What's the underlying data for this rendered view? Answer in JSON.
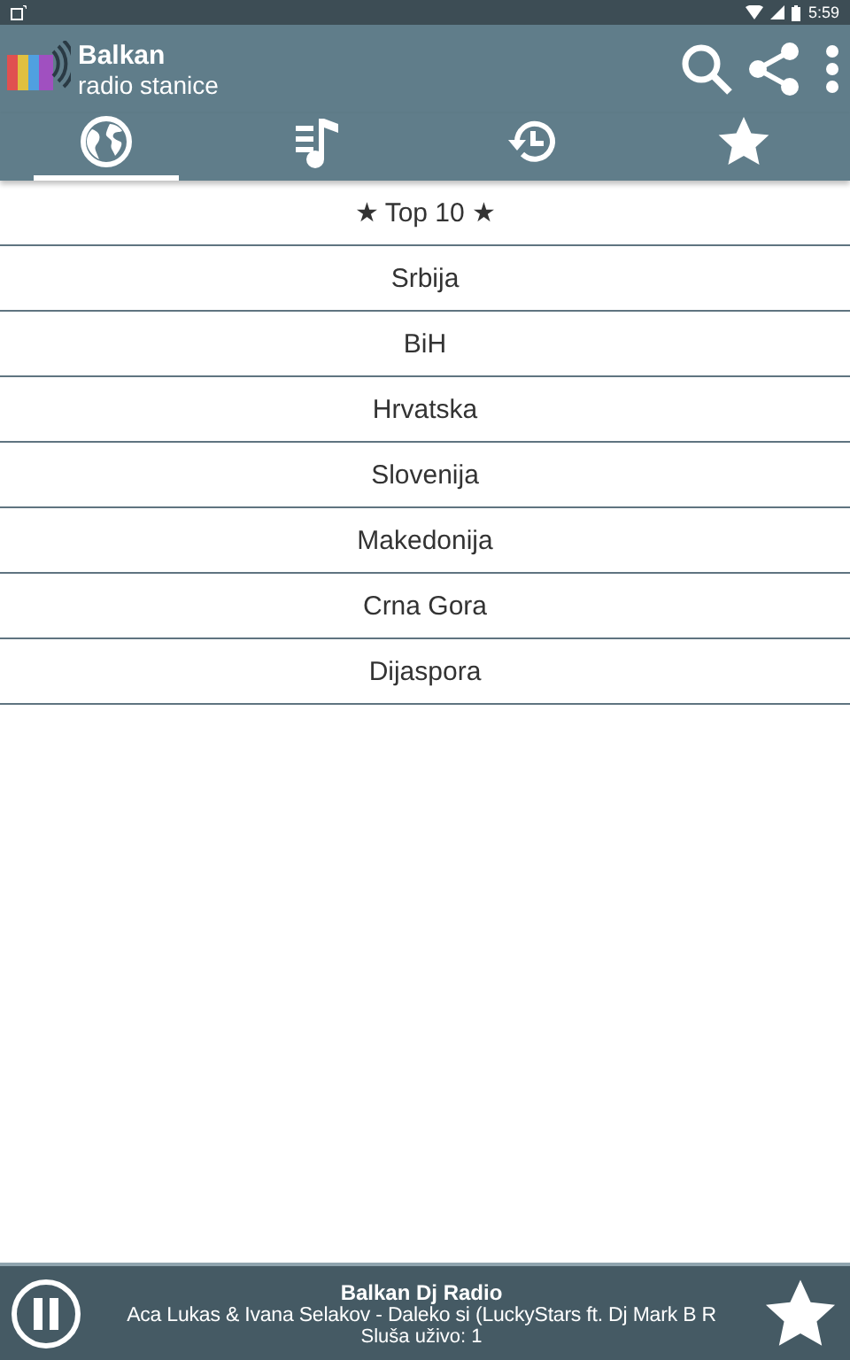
{
  "status_bar": {
    "time": "5:59"
  },
  "app_bar": {
    "title": "Balkan",
    "subtitle": "radio stanice"
  },
  "tabs": [
    {
      "kind": "globe",
      "selected": true
    },
    {
      "kind": "playlist",
      "selected": false
    },
    {
      "kind": "history",
      "selected": false
    },
    {
      "kind": "star",
      "selected": false
    }
  ],
  "categories": [
    "★ Top 10 ★",
    "Srbija",
    "BiH",
    "Hrvatska",
    "Slovenija",
    "Makedonija",
    "Crna Gora",
    "Dijaspora"
  ],
  "player": {
    "playing": true,
    "station": "Balkan Dj Radio",
    "track": "Aca Lukas & Ivana Selakov - Daleko si (LuckyStars ft. Dj Mark B R",
    "listeners": "Sluša uživo: 1"
  }
}
